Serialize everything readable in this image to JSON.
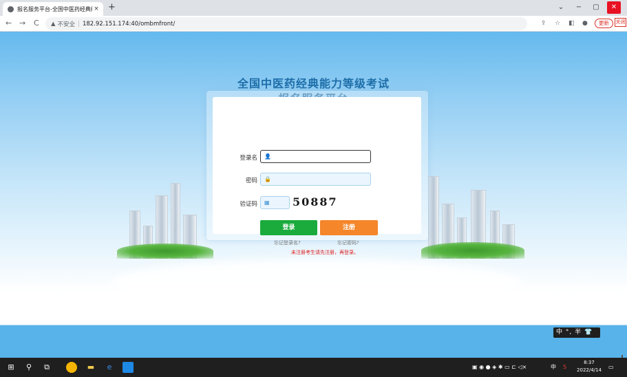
{
  "browser": {
    "tab_title": "报名服务平台-全国中医药经典能",
    "tab_close": "×",
    "new_tab": "+",
    "window_controls": {
      "minimize": "−",
      "maximize": "▢",
      "close": "✕",
      "chevron": "⌄"
    },
    "nav": {
      "back": "←",
      "forward": "→",
      "reload": "C"
    },
    "security_label": "不安全",
    "url": "182.92.151.174:40/ombmfront/",
    "update_label": "更新",
    "close_tag_label": "关闭"
  },
  "page": {
    "title_line1": "全国中医药经典能力等级考试",
    "title_line2": "报名服务平台"
  },
  "login": {
    "username_label": "登录名",
    "password_label": "密码",
    "captcha_label": "验证码",
    "captcha_text": "50887",
    "login_button": "登录",
    "register_button": "注册",
    "forgot_username": "忘记登录名?",
    "forgot_password": "忘记密码?",
    "notice": "未注册考生请先注册，再登录。"
  },
  "ime": {
    "label": "中 °, 半 👕"
  },
  "taskbar": {
    "time": "8:37",
    "date": "2022/4/14",
    "ime_mode": "中"
  },
  "colors": {
    "login_green": "#1aab3c",
    "register_orange": "#f5862a",
    "title_blue": "#1d6da8",
    "notice_red": "#e02020"
  }
}
